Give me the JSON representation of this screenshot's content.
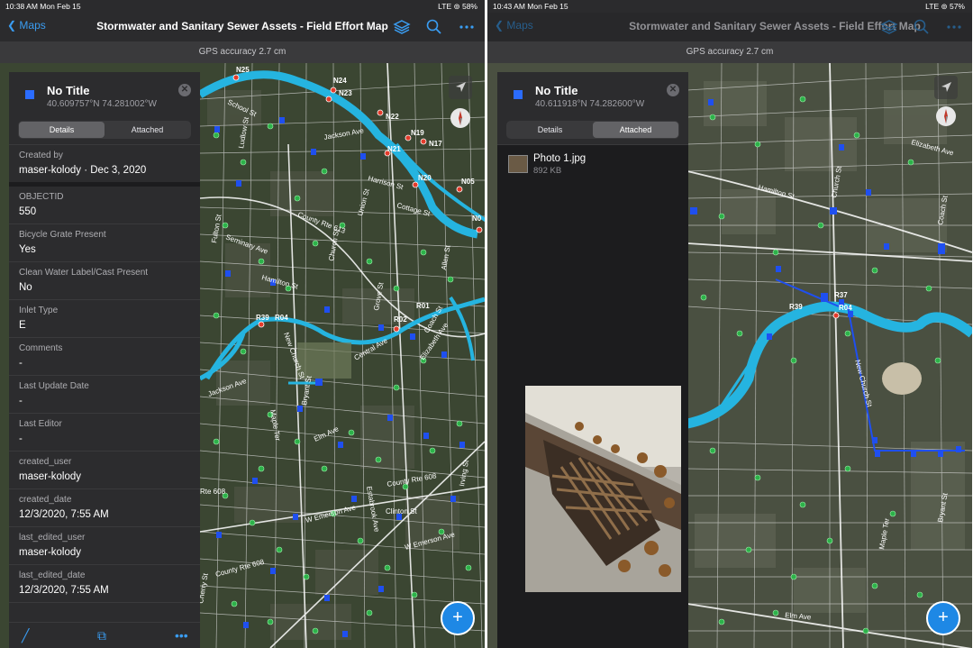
{
  "left": {
    "status": {
      "time_date": "10:38 AM   Mon Feb 15",
      "right": "LTE ⊚ 58%"
    },
    "nav": {
      "back_label": "Maps",
      "title": "Stormwater and Sanitary Sewer Assets - Field Effort Map"
    },
    "gps": "GPS accuracy 2.7 cm",
    "panel": {
      "title": "No Title",
      "coords": "40.609757°N  74.281002°W",
      "tabs": [
        "Details",
        "Attached"
      ],
      "created_label": "Created by",
      "created_value": "maser-kolody · Dec 3, 2020",
      "fields": [
        {
          "label": "OBJECTID",
          "value": "550"
        },
        {
          "label": "Bicycle Grate Present",
          "value": "Yes"
        },
        {
          "label": "Clean Water Label/Cast Present",
          "value": "No"
        },
        {
          "label": "Inlet Type",
          "value": "E"
        },
        {
          "label": "Comments",
          "value": "-"
        },
        {
          "label": "Last Update Date",
          "value": "-"
        },
        {
          "label": "Last Editor",
          "value": "-"
        },
        {
          "label": "created_user",
          "value": "maser-kolody"
        },
        {
          "label": "created_date",
          "value": "12/3/2020, 7:55 AM"
        },
        {
          "label": "last_edited_user",
          "value": "maser-kolody"
        },
        {
          "label": "last_edited_date",
          "value": "12/3/2020, 7:55 AM"
        }
      ]
    },
    "map_labels": {
      "streets": [
        "School St",
        "Jackson Ave",
        "Harrison St",
        "Cottage St",
        "Union St",
        "County Rte 613",
        "Seminary Ave",
        "Hamilton St",
        "Central Ave",
        "Elizabeth Ave",
        "Coach St",
        "Elm Ave",
        "Maple Ter",
        "Bryant St",
        "Clinton St",
        "W Emerson Ave",
        "Estabrook Ave",
        "County Rte 608",
        "Irving St",
        "W Emerson Ave",
        "County Rte 608",
        "Ludlow St",
        "Fulton St",
        "Church St",
        "Allen St",
        "New Church St",
        "Grove St",
        "Rte 608",
        "Cherry St",
        "Jackson Ave"
      ],
      "nodes": [
        "N25",
        "N24",
        "N23",
        "N22",
        "N19",
        "N17",
        "N21",
        "N20",
        "N05",
        "N0",
        "R02",
        "R01",
        "R39",
        "R04"
      ]
    }
  },
  "right": {
    "status": {
      "time_date": "10:43 AM   Mon Feb 15",
      "right": "LTE ⊚ 57%"
    },
    "nav": {
      "back_label": "Maps",
      "title": "Stormwater and Sanitary Sewer Assets - Field Effort Map"
    },
    "gps": "GPS accuracy 2.7 cm",
    "panel": {
      "title": "No Title",
      "coords": "40.611918°N  74.282600°W",
      "tabs": [
        "Details",
        "Attached"
      ],
      "attachment": {
        "name": "Photo 1.jpg",
        "size": "892 KB"
      }
    },
    "map_labels": {
      "streets": [
        "Hamilton St",
        "Church St",
        "Bryant St",
        "Maple Ter",
        "Elm Ave",
        "New Church St",
        "Elizabeth Ave",
        "Coach St"
      ],
      "nodes": [
        "R37",
        "R39",
        "R04"
      ]
    }
  },
  "colors": {
    "accent": "#3a9df2",
    "stream": "#25b4e0",
    "inlet": "#1f4ff0",
    "manhole": "#2db24a",
    "node": "#e33b2b"
  },
  "icons": [
    "chevron-left-icon",
    "layers-icon",
    "search-icon",
    "more-icon",
    "location-arrow-icon",
    "compass-icon",
    "plus-icon",
    "edit-icon",
    "duplicate-icon",
    "close-icon"
  ]
}
